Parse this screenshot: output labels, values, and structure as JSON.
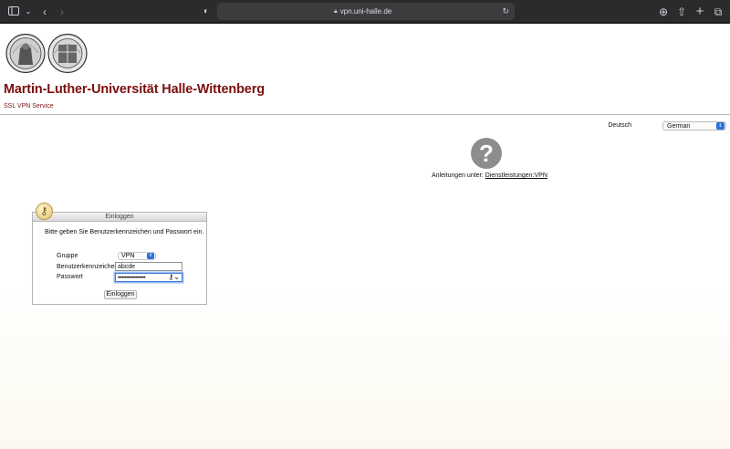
{
  "browser": {
    "url": "vpn.uni-halle.de",
    "icons": [
      "sidebar-icon",
      "chevron-down-icon",
      "back-icon",
      "forward-icon",
      "shield-icon",
      "lock-icon",
      "reload-icon",
      "download-icon",
      "share-icon",
      "new-tab-icon",
      "tabs-icon"
    ]
  },
  "header": {
    "title": "Martin-Luther-Universität Halle-Wittenberg",
    "subtitle": "SSL VPN Service"
  },
  "language": {
    "label": "Deutsch",
    "selected": "German"
  },
  "help": {
    "text": "Anleitungen unter:",
    "link": "Dienstleistungen:VPN"
  },
  "login": {
    "title": "Einloggen",
    "prompt": "Bitte geben Sie Benutzerkennzeichen und Passwort ein.",
    "group_label": "Gruppe",
    "group_value": "VPN",
    "user_label": "Benutzerkennzeichen",
    "user_value": "abcde",
    "password_label": "Passwort",
    "password_mask": "••••••••••••••••••••",
    "submit_label": "Einloggen"
  },
  "colors": {
    "brand": "#7a0f0f",
    "accent": "#2f6fd9"
  }
}
